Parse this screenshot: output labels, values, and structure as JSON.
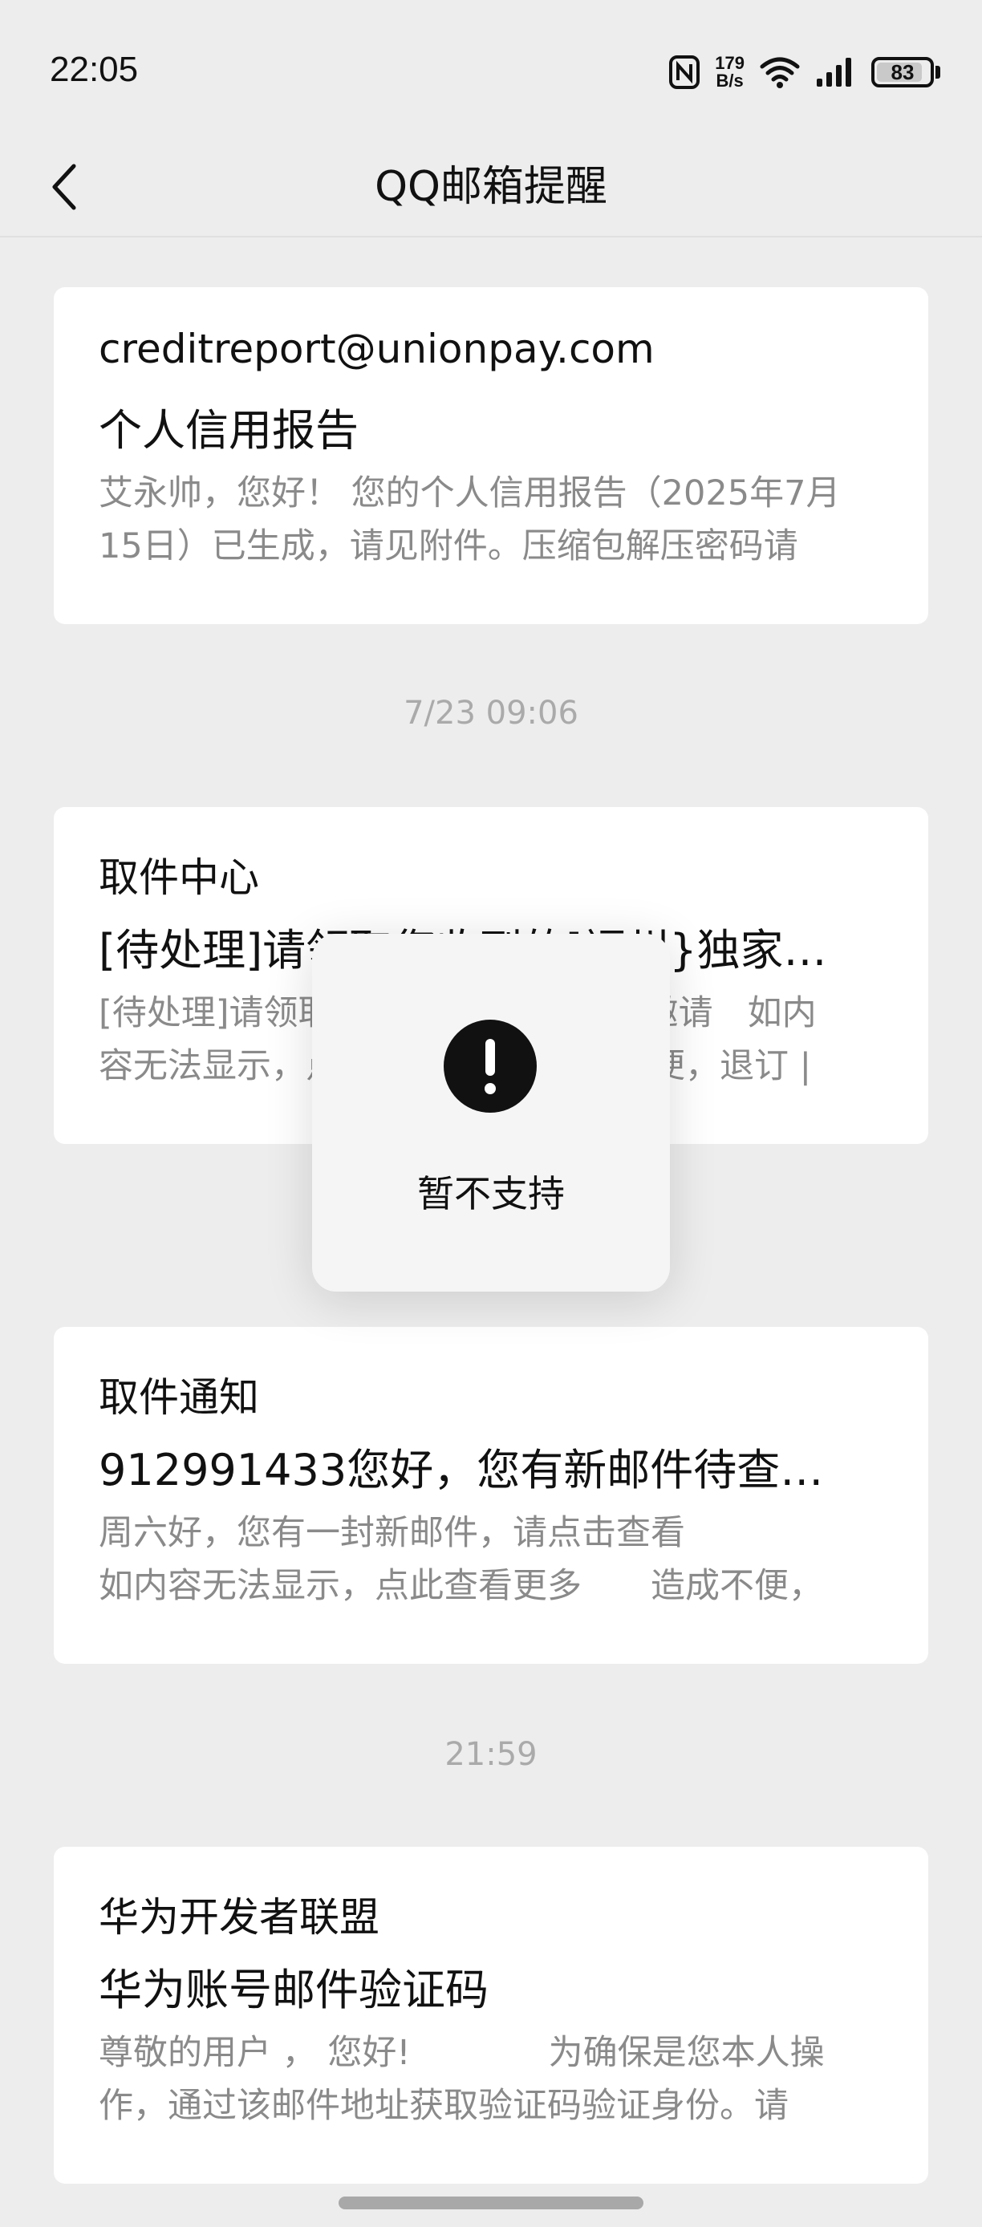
{
  "status_bar": {
    "time": "22:05",
    "speed_value": "179",
    "speed_unit": "B/s",
    "battery": "83",
    "icons": [
      "nfc-icon",
      "wifi-icon",
      "signal-icon",
      "battery-icon"
    ]
  },
  "header": {
    "title": "QQ邮箱提醒",
    "back_icon": "chevron-left-icon"
  },
  "messages": [
    {
      "sender": "creditreport@unionpay.com",
      "subject": "个人信用报告",
      "preview_line1": "艾永帅，您好！ 您的个人信用报告（2025年7月",
      "preview_line2": "15日）已生成，请见附件。压缩包解压密码请"
    },
    {
      "sender": "取件中心",
      "subject": "[待处理]请领取您收到的[福州}独家…",
      "preview_line1": "[待处理]请领取您收到的[福州}独家邀请　如内",
      "preview_line2": "容无法显示，点此查看更多　造成不便，退订 |"
    },
    {
      "sender": "取件通知",
      "subject": "912991433您好，您有新邮件待查收…",
      "preview_line1": "周六好，您有一封新邮件，请点击查看",
      "preview_line2": "如内容无法显示，点此查看更多　　造成不便，"
    },
    {
      "sender": "华为开发者联盟",
      "subject": "华为账号邮件验证码",
      "preview_line1": "尊敬的用户 ， 您好!　　　　为确保是您本人操",
      "preview_line2": "作，通过该邮件地址获取验证码验证身份。请"
    }
  ],
  "timestamps": [
    "7/23 09:06",
    "21:59"
  ],
  "toast": {
    "icon": "exclamation-circle-icon",
    "text": "暂不支持"
  },
  "colors": {
    "background": "#ededed",
    "card": "#ffffff",
    "preview_text": "#8a8a8a",
    "timestamp_text": "#aaaaaa"
  }
}
